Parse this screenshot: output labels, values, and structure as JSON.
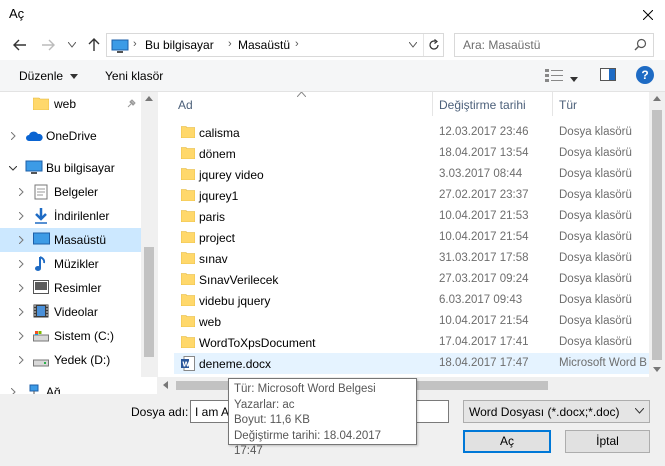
{
  "window": {
    "title": "Aç"
  },
  "address": {
    "crumbs": [
      "Bu bilgisayar",
      "Masaüstü"
    ],
    "search_placeholder": "Ara: Masaüstü"
  },
  "toolbar": {
    "organize": "Düzenle",
    "new_folder": "Yeni klasör"
  },
  "nav": {
    "items": [
      {
        "label": "web",
        "icon": "folder-icon"
      },
      {
        "label": "OneDrive",
        "icon": "cloud-icon"
      },
      {
        "label": "Bu bilgisayar",
        "icon": "computer-icon"
      },
      {
        "label": "Belgeler",
        "icon": "documents-icon"
      },
      {
        "label": "İndirilenler",
        "icon": "download-icon"
      },
      {
        "label": "Masaüstü",
        "icon": "desktop-icon",
        "selected": true
      },
      {
        "label": "Müzikler",
        "icon": "music-icon"
      },
      {
        "label": "Resimler",
        "icon": "pictures-icon"
      },
      {
        "label": "Videolar",
        "icon": "videos-icon"
      },
      {
        "label": "Sistem (C:)",
        "icon": "drive-icon"
      },
      {
        "label": "Yedek (D:)",
        "icon": "drive-icon"
      },
      {
        "label": "Ağ",
        "icon": "network-icon"
      }
    ]
  },
  "columns": {
    "name": "Ad",
    "date": "Değiştirme tarihi",
    "type": "Tür"
  },
  "files": [
    {
      "name": "calisma",
      "date": "12.03.2017 23:46",
      "type": "Dosya klasörü",
      "icon": "folder-icon"
    },
    {
      "name": "dönem",
      "date": "18.04.2017 13:54",
      "type": "Dosya klasörü",
      "icon": "folder-icon"
    },
    {
      "name": "jqurey video",
      "date": "3.03.2017 08:44",
      "type": "Dosya klasörü",
      "icon": "folder-icon"
    },
    {
      "name": "jqurey1",
      "date": "27.02.2017 23:37",
      "type": "Dosya klasörü",
      "icon": "folder-icon"
    },
    {
      "name": "paris",
      "date": "10.04.2017 21:53",
      "type": "Dosya klasörü",
      "icon": "folder-icon"
    },
    {
      "name": "project",
      "date": "10.04.2017 21:54",
      "type": "Dosya klasörü",
      "icon": "folder-icon"
    },
    {
      "name": "sınav",
      "date": "31.03.2017 17:58",
      "type": "Dosya klasörü",
      "icon": "folder-icon"
    },
    {
      "name": "SınavVerilecek",
      "date": "27.03.2017 09:24",
      "type": "Dosya klasörü",
      "icon": "folder-icon"
    },
    {
      "name": "videbu jquery",
      "date": "6.03.2017 09:43",
      "type": "Dosya klasörü",
      "icon": "folder-icon"
    },
    {
      "name": "web",
      "date": "10.04.2017 21:54",
      "type": "Dosya klasörü",
      "icon": "folder-icon"
    },
    {
      "name": "WordToXpsDocument",
      "date": "17.04.2017 17:41",
      "type": "Dosya klasörü",
      "icon": "folder-icon"
    },
    {
      "name": "deneme.docx",
      "date": "18.04.2017 17:47",
      "type": "Microsoft Word B",
      "icon": "word-icon"
    }
  ],
  "tooltip": {
    "line1": "Tür: Microsoft Word Belgesi",
    "line2": "Yazarlar: ac",
    "line3": "Boyut: 11,6 KB",
    "line4": "Değiştirme tarihi: 18.04.2017 17:47"
  },
  "bottom": {
    "filename_label": "Dosya adı:",
    "filename_value": "I am A",
    "filetype": "Word Dosyası (*.docx;*.doc)",
    "open": "Aç",
    "cancel": "İptal"
  },
  "colors": {
    "selection": "#cce8ff",
    "hover": "#e5f3ff",
    "folder": "#ffd86b",
    "accent": "#0078d7"
  }
}
